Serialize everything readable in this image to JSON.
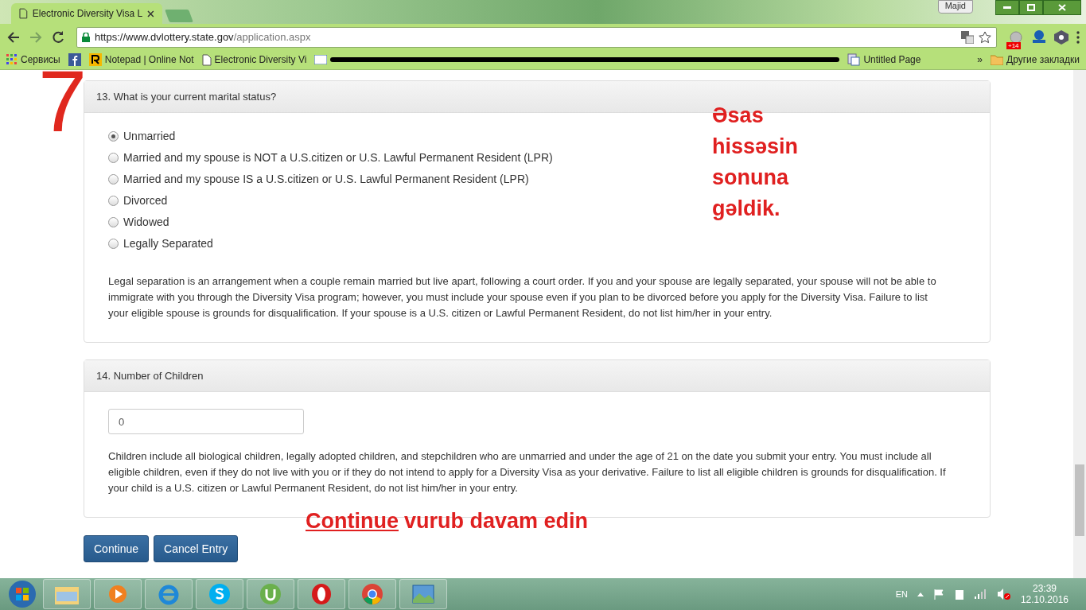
{
  "browser": {
    "tabs": [
      {
        "title": "Electronic Diversity Visa L",
        "selected": true
      }
    ],
    "profile": "Majid",
    "address": {
      "host": "https://www.dvlottery.state.gov",
      "path": "/application.aspx"
    },
    "extension_badge": "+14",
    "bookmarks": [
      {
        "label": "Сервисы",
        "kind": "apps"
      },
      {
        "kind": "facebook"
      },
      {
        "label": "Notepad | Online Not",
        "kind": "notepad"
      },
      {
        "label": "Electronic Diversity Vi",
        "kind": "page"
      },
      {
        "kind": "redacted"
      },
      {
        "label": "Untitled Page",
        "kind": "untitled"
      }
    ],
    "more": "»",
    "other_bookmarks": "Другие закладки"
  },
  "sections": [
    {
      "title": "13. What is your current marital status?",
      "kind": "radio",
      "options": [
        {
          "label": "Unmarried",
          "selected": true
        },
        {
          "label": "Married and my spouse is NOT a U.S.citizen or U.S. Lawful Permanent Resident (LPR)",
          "selected": false
        },
        {
          "label": "Married and my spouse IS a U.S.citizen or U.S. Lawful Permanent Resident (LPR)",
          "selected": false
        },
        {
          "label": "Divorced",
          "selected": false
        },
        {
          "label": "Widowed",
          "selected": false
        },
        {
          "label": "Legally Separated",
          "selected": false
        }
      ],
      "note": "Legal separation is an arrangement when a couple remain married but live apart, following a court order. If you and your spouse are legally separated, your spouse will not be able to immigrate with you through the Diversity Visa program; however, you must include your spouse even if you plan to be divorced before you apply for the Diversity Visa. Failure to list your eligible spouse is grounds for disqualification. If your spouse is a U.S. citizen or Lawful Permanent Resident, do not list him/her in your entry."
    },
    {
      "title": "14. Number of Children",
      "kind": "input",
      "value": "0",
      "note": "Children include all biological children, legally adopted children, and stepchildren who are unmarried and under the age of 21 on the date you submit your entry. You must include all eligible children, even if they do not live with you or if they do not intend to apply for a Diversity Visa as your derivative. Failure to list all eligible children is grounds for disqualification. If your child is a U.S. citizen or Lawful Permanent Resident, do not list him/her in your entry."
    }
  ],
  "buttons": [
    "Continue",
    "Cancel Entry"
  ],
  "annotations": {
    "step": "7",
    "note_lines": [
      "Əsas",
      "hissəsin",
      "sonuna",
      "gəldik."
    ],
    "continue_word": "Continue",
    "continue_rest": "vurub davam edin"
  },
  "taskbar": {
    "language": "EN",
    "time": "23:39",
    "date": "12.10.2016"
  }
}
